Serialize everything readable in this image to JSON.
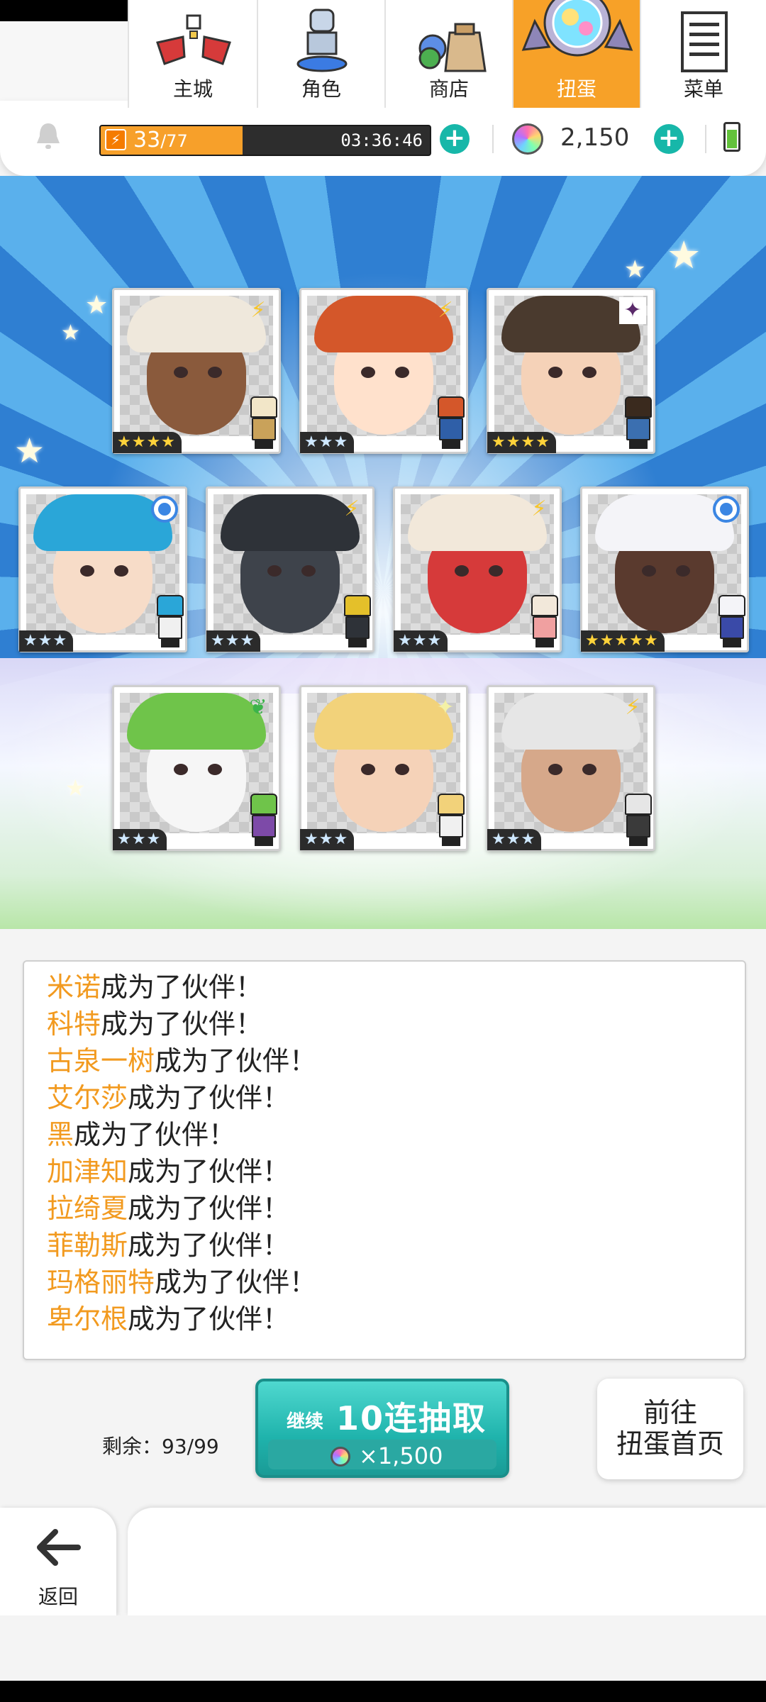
{
  "hud": {
    "stamina_current": "33",
    "stamina_max": "/77",
    "stamina_fraction": 0.43,
    "stamina_timer": "03:36:46",
    "gems": "2,150"
  },
  "cards": [
    {
      "stars": "★★★★",
      "element": "lightning"
    },
    {
      "stars": "★★★",
      "element": "lightning"
    },
    {
      "stars": "★★★★",
      "element": "dark"
    },
    {
      "stars": "★★★",
      "element": "water"
    },
    {
      "stars": "★★★",
      "element": "lightning"
    },
    {
      "stars": "★★★",
      "element": "lightning"
    },
    {
      "stars": "★★★★★",
      "element": "water"
    },
    {
      "stars": "★★★",
      "element": "wind"
    },
    {
      "stars": "★★★",
      "element": "light"
    },
    {
      "stars": "★★★",
      "element": "lightning"
    }
  ],
  "log": {
    "suffix": "成为了伙伴！",
    "names": [
      "米诺",
      "科特",
      "古泉一树",
      "艾尔莎",
      "黑",
      "加津知",
      "拉绮夏",
      "菲勒斯",
      "玛格丽特",
      "卑尔根"
    ]
  },
  "actions": {
    "remaining": "剩余：93/99",
    "pull_prefix": "继续",
    "pull_label": "10连抽取",
    "pull_cost": "×1,500",
    "go_line1": "前往",
    "go_line2": "扭蛋首页"
  },
  "nav": {
    "back": "返回",
    "items": [
      "主城",
      "角色",
      "商店",
      "扭蛋",
      "菜单"
    ],
    "active": "扭蛋"
  }
}
